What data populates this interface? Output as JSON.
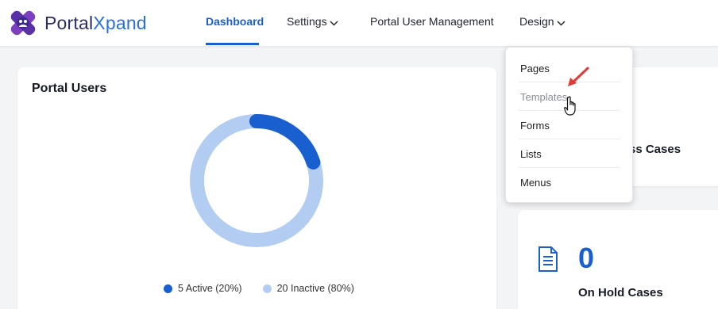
{
  "brand": {
    "part1": "Portal",
    "part2": "Xpand"
  },
  "nav": {
    "dashboard": "Dashboard",
    "settings": "Settings",
    "portal_user_management": "Portal User Management",
    "design": "Design"
  },
  "design_menu": [
    "Pages",
    "Templates",
    "Forms",
    "Lists",
    "Menus"
  ],
  "portal_users": {
    "title": "Portal Users",
    "legend_active": "5 Active (20%)",
    "legend_inactive": "20 Inactive (80%)",
    "active_fraction": 0.2,
    "colors": {
      "active": "#1a5fd0",
      "inactive": "#b3cdf2"
    }
  },
  "progress_card": {
    "label_partial": "ss Cases"
  },
  "on_hold": {
    "count": "0",
    "label": "On Hold Cases"
  },
  "icons": [
    "portalxpand-logo-icon",
    "chevron-down-icon",
    "document-icon",
    "red-arrow-icon",
    "hand-cursor-icon"
  ]
}
